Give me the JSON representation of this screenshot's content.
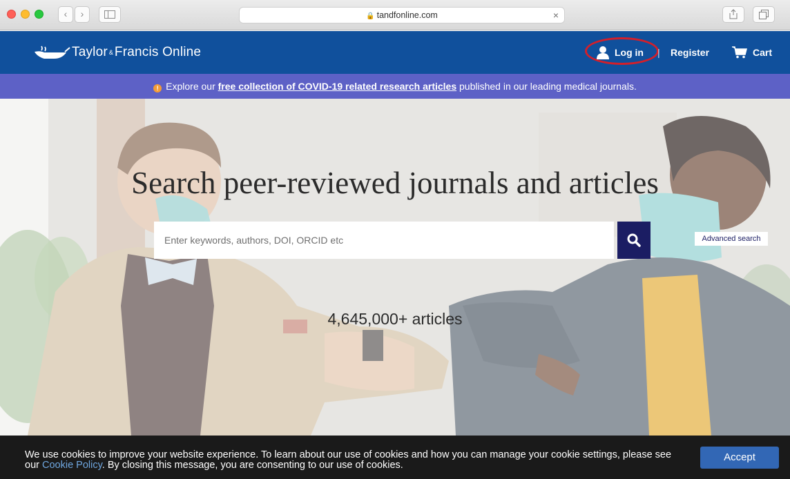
{
  "browser": {
    "url": "tandfonline.com"
  },
  "header": {
    "logo": {
      "part1": "Taylor",
      "amp": "&",
      "part2": "Francis Online"
    },
    "login_label": "Log in",
    "separator": "|",
    "register_label": "Register",
    "cart_label": "Cart"
  },
  "banner": {
    "prefix": "Explore our ",
    "link_text": "free collection of COVID-19 related research articles",
    "suffix": " published in our leading medical journals."
  },
  "hero": {
    "title": "Search peer-reviewed journals and articles",
    "search_placeholder": "Enter keywords, authors, DOI, ORCID etc",
    "advanced_search_label": "Advanced search",
    "article_count": "4,645,000+ articles"
  },
  "cookie": {
    "text_before": "We use cookies to improve your website experience. To learn about our use of cookies and how you can manage your cookie settings, please see our ",
    "policy_link": "Cookie Policy",
    "text_after": ". By closing this message, you are consenting to our use of cookies.",
    "accept_label": "Accept"
  },
  "icons": [
    "back-icon",
    "forward-icon",
    "sidebar-icon",
    "lock-icon",
    "clear-icon",
    "share-icon",
    "tabs-icon",
    "logo-lamp-icon",
    "user-icon",
    "cart-icon",
    "warning-icon",
    "search-icon"
  ],
  "colors": {
    "header": "#10509c",
    "banner": "#5d61c6",
    "search_button": "#1b1d63",
    "login_highlight": "#d41f2a",
    "accept_button": "#3267b5",
    "cookie_bar": "#1a1a1a"
  }
}
